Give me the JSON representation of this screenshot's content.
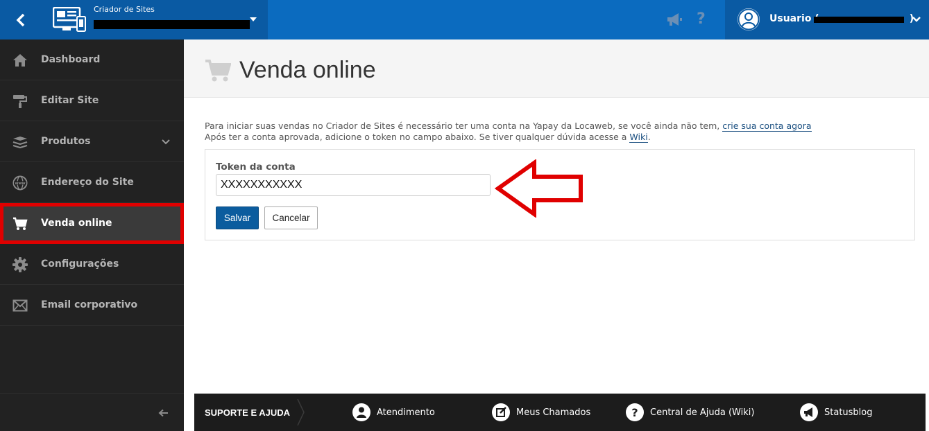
{
  "topbar": {
    "site_label": "Criador de Sites",
    "user_label": "Usuario (",
    "user_label_end": ")",
    "help_glyph": "?"
  },
  "sidebar": {
    "items": [
      {
        "label": "Dashboard",
        "icon": "home-icon"
      },
      {
        "label": "Editar Site",
        "icon": "paint-roller-icon"
      },
      {
        "label": "Produtos",
        "icon": "layers-icon"
      },
      {
        "label": "Endereço do Site",
        "icon": "globe-www-icon"
      },
      {
        "label": "Venda online",
        "icon": "cart-icon"
      },
      {
        "label": "Configurações",
        "icon": "gear-icon"
      },
      {
        "label": "Email corporativo",
        "icon": "envelope-icon"
      }
    ]
  },
  "main": {
    "title": "Venda online",
    "intro_line1": "Para iniciar suas vendas no Criador de Sites é necessário ter uma conta na Yapay da Locaweb, se você ainda não tem, ",
    "intro_link1": "crie sua conta agora",
    "intro_line2": "Após ter a conta aprovada, adicione o token no campo abaixo. Se tiver qualquer dúvida acesse a ",
    "intro_link2": "Wiki",
    "intro_end": ".",
    "form": {
      "token_label": "Token da conta",
      "token_value": "XXXXXXXXXXX",
      "save_label": "Salvar",
      "cancel_label": "Cancelar"
    }
  },
  "footer": {
    "title": "SUPORTE E AJUDA",
    "links": [
      {
        "label": "Atendimento",
        "icon": "user-circle-icon"
      },
      {
        "label": "Meus Chamados",
        "icon": "edit-icon"
      },
      {
        "label": "Central de Ajuda (Wiki)",
        "icon": "question-circle-icon"
      },
      {
        "label": "Statusblog",
        "icon": "megaphone-icon"
      }
    ]
  },
  "colors": {
    "topbar": "#0b6bbf",
    "topbar_dark": "#0a5aa3",
    "sidebar": "#222222",
    "active_highlight": "#e00000",
    "save_button": "#0b5c9e"
  }
}
